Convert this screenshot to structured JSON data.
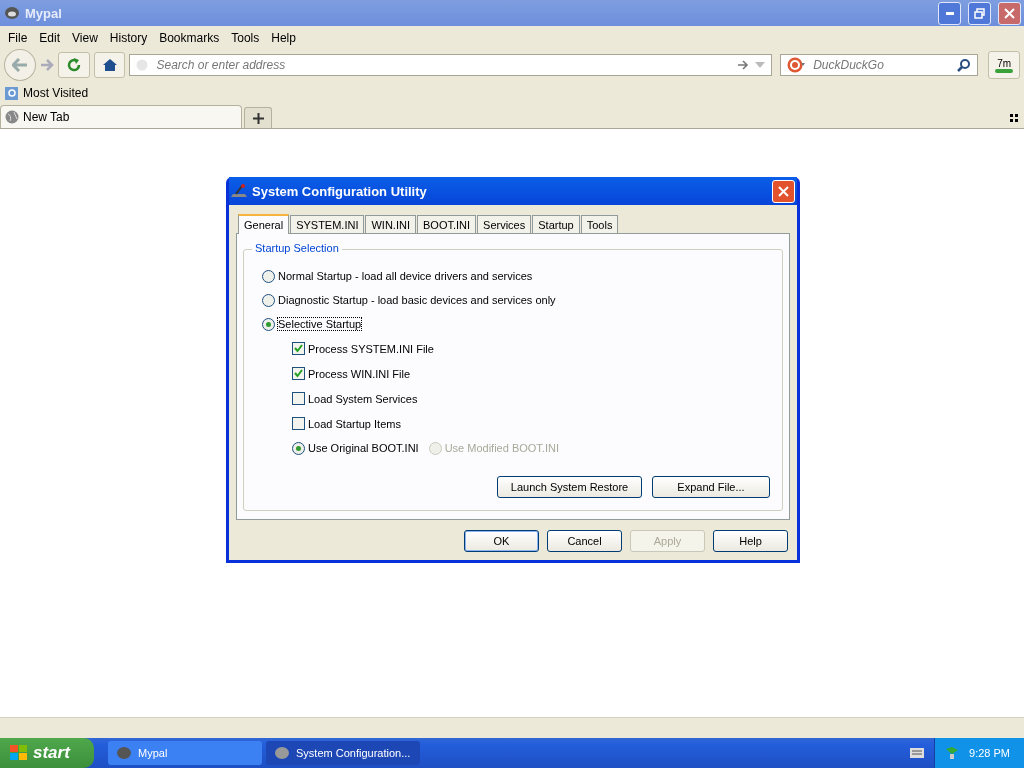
{
  "window": {
    "title": "Mypal"
  },
  "menu": [
    "File",
    "Edit",
    "View",
    "History",
    "Bookmarks",
    "Tools",
    "Help"
  ],
  "address_bar": {
    "placeholder": "Search or enter address"
  },
  "search_bar": {
    "placeholder": "DuckDuckGo"
  },
  "addon_badge": "7m",
  "bookmarks": [
    {
      "label": "Most Visited"
    }
  ],
  "browser_tabs": [
    {
      "label": "New Tab",
      "selected": true
    }
  ],
  "dialog": {
    "title": "System Configuration Utility",
    "tabs": [
      {
        "label": "General",
        "selected": true
      },
      {
        "label": "SYSTEM.INI",
        "selected": false
      },
      {
        "label": "WIN.INI",
        "selected": false
      },
      {
        "label": "BOOT.INI",
        "selected": false
      },
      {
        "label": "Services",
        "selected": false
      },
      {
        "label": "Startup",
        "selected": false
      },
      {
        "label": "Tools",
        "selected": false
      }
    ],
    "group_title": "Startup Selection",
    "startup_options": [
      {
        "label": "Normal Startup - load all device drivers and services",
        "selected": false
      },
      {
        "label": "Diagnostic Startup - load basic devices and services only",
        "selected": false
      },
      {
        "label": "Selective Startup",
        "selected": true
      }
    ],
    "items": [
      {
        "label": "Process SYSTEM.INI File",
        "checked": true
      },
      {
        "label": "Process WIN.INI File",
        "checked": true
      },
      {
        "label": "Load System Services",
        "checked": false
      },
      {
        "label": "Load Startup Items",
        "checked": false
      }
    ],
    "boot_options": [
      {
        "label": "Use Original BOOT.INI",
        "selected": true,
        "disabled": false
      },
      {
        "label": "Use Modified BOOT.INI",
        "selected": false,
        "disabled": true
      }
    ],
    "actions": [
      "Launch System Restore",
      "Expand File..."
    ],
    "buttons": [
      {
        "label": "OK",
        "default": true,
        "disabled": false
      },
      {
        "label": "Cancel",
        "default": false,
        "disabled": false
      },
      {
        "label": "Apply",
        "default": false,
        "disabled": true
      },
      {
        "label": "Help",
        "default": false,
        "disabled": false
      }
    ]
  },
  "taskbar": {
    "start": "start",
    "tasks": [
      {
        "label": "Mypal",
        "selected": false
      },
      {
        "label": "System Configuration...",
        "selected": true
      }
    ],
    "clock": "9:28 PM"
  }
}
